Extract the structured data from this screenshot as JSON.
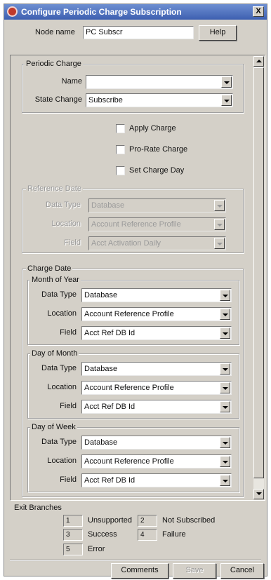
{
  "window": {
    "title": "Configure Periodic Charge Subscription",
    "close_glyph": "X"
  },
  "node": {
    "label": "Node name",
    "value": "PC Subscr",
    "help_button": "Help"
  },
  "periodic_charge": {
    "group_title": "Periodic Charge",
    "name_label": "Name",
    "name_value": "",
    "state_change_label": "State Change",
    "state_change_value": "Subscribe"
  },
  "options": {
    "apply_charge": {
      "label": "Apply Charge",
      "checked": false
    },
    "pro_rate_charge": {
      "label": "Pro-Rate Charge",
      "checked": false
    },
    "set_charge_day": {
      "label": "Set Charge Day",
      "checked": false
    }
  },
  "reference_date": {
    "group_title": "Reference Date",
    "enabled": false,
    "data_type_label": "Data Type",
    "data_type_value": "Database",
    "location_label": "Location",
    "location_value": "Account Reference Profile",
    "field_label": "Field",
    "field_value": "Acct Activation Daily"
  },
  "charge_date": {
    "group_title": "Charge Date",
    "sections": [
      {
        "title": "Month of Year",
        "data_type_label": "Data Type",
        "data_type_value": "Database",
        "location_label": "Location",
        "location_value": "Account Reference Profile",
        "field_label": "Field",
        "field_value": "Acct Ref DB Id"
      },
      {
        "title": "Day of Month",
        "data_type_label": "Data Type",
        "data_type_value": "Database",
        "location_label": "Location",
        "location_value": "Account Reference Profile",
        "field_label": "Field",
        "field_value": "Acct Ref DB Id"
      },
      {
        "title": "Day of Week",
        "data_type_label": "Data Type",
        "data_type_value": "Database",
        "location_label": "Location",
        "location_value": "Account Reference Profile",
        "field_label": "Field",
        "field_value": "Acct Ref DB Id"
      }
    ]
  },
  "exit_branches": {
    "title": "Exit Branches",
    "items": [
      {
        "number": "1",
        "label": "Unsupported"
      },
      {
        "number": "2",
        "label": "Not Subscribed"
      },
      {
        "number": "3",
        "label": "Success"
      },
      {
        "number": "4",
        "label": "Failure"
      },
      {
        "number": "5",
        "label": "Error"
      }
    ]
  },
  "footer": {
    "comments_button": "Comments",
    "save_button": "Save",
    "save_enabled": false,
    "cancel_button": "Cancel"
  },
  "colors": {
    "titlebar": "#3d5fb0",
    "dialog_bg": "#d4d0c8",
    "disabled_text": "#9a9a9a"
  },
  "icons": {
    "title_icon": "app-icon",
    "close": "close-icon",
    "dropdown": "chevron-down-icon",
    "scroll_up": "scroll-up-icon",
    "scroll_down": "scroll-down-icon"
  }
}
